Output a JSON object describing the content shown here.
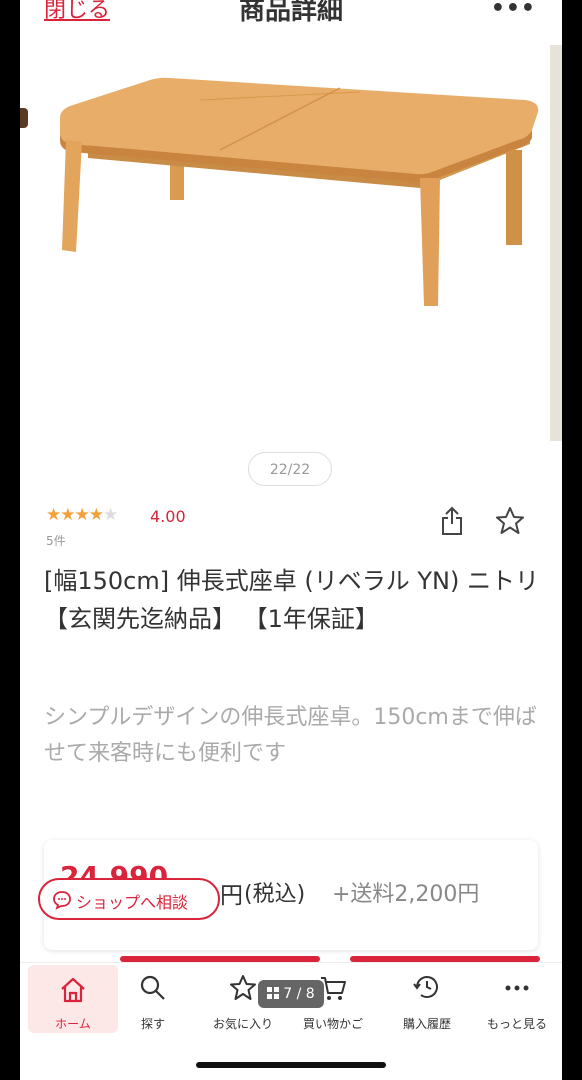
{
  "header": {
    "close_label": "閉じる",
    "title": "商品詳細",
    "more_label": "•••"
  },
  "gallery": {
    "counter": "22/22"
  },
  "rating": {
    "stars": 4,
    "max_stars": 5,
    "value": "4.00",
    "count": "5件"
  },
  "product": {
    "name": "[幅150cm] 伸長式座卓 (リベラル YN) ニトリ 【玄関先迄納品】 【1年保証】",
    "description": "シンプルデザインの伸長式座卓。150cmまで伸ばせて来客時にも便利です"
  },
  "price": {
    "amount": "24,990",
    "currency": "円",
    "tax": "(税込)",
    "shipping": "+送料2,200円"
  },
  "consult_button": {
    "label": "ショップへ相談"
  },
  "tabbar": {
    "items": [
      {
        "label": "ホーム",
        "icon": "home-icon"
      },
      {
        "label": "探す",
        "icon": "search-icon"
      },
      {
        "label": "お気に入り",
        "icon": "star-icon"
      },
      {
        "label": "買い物かご",
        "icon": "cart-icon"
      },
      {
        "label": "購入履歴",
        "icon": "history-icon"
      },
      {
        "label": "もっと見る",
        "icon": "more-icon"
      }
    ]
  },
  "pager": {
    "label": "7 / 8"
  },
  "colors": {
    "accent": "#d9243b",
    "star": "#f2a13a",
    "wood": "#e3a560"
  }
}
